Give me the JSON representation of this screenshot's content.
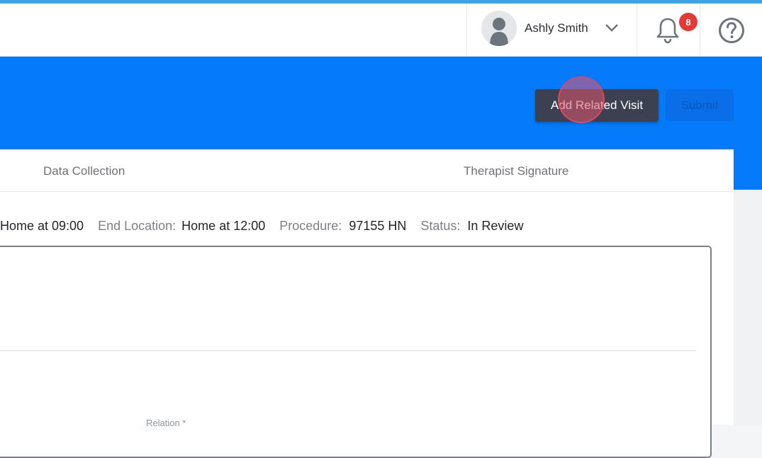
{
  "header": {
    "user_name": "Ashly Smith",
    "notification_count": "8",
    "icons": [
      "avatar-icon",
      "chevron-down-icon",
      "bell-icon",
      "help-icon"
    ]
  },
  "actions": {
    "add_related_visit_label": "Add Related Visit",
    "submit_label": "Submit"
  },
  "tabs": [
    {
      "label": "Data Collection"
    },
    {
      "label": "Therapist Signature"
    }
  ],
  "visit_info": {
    "start_location_value": "Home at 09:00",
    "end_location_label": "End Location:",
    "end_location_value": "Home at 12:00",
    "procedure_label": "Procedure:",
    "procedure_value": "97155 HN",
    "status_label": "Status:",
    "status_value": "In Review"
  },
  "form": {
    "relation_label": "Relation *"
  },
  "colors": {
    "accent_blue": "#057bfb",
    "top_accent": "#3aa6e8",
    "dark_button": "#3b4150",
    "badge_red": "#e53935"
  }
}
